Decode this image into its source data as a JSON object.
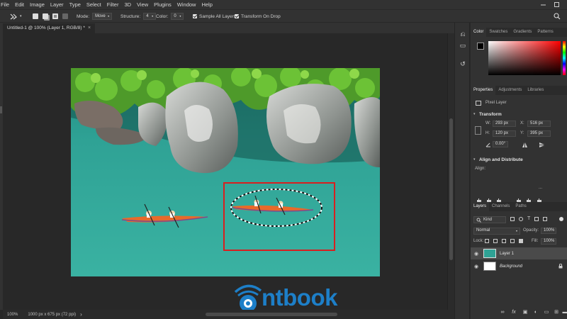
{
  "menubar": {
    "items": [
      "File",
      "Edit",
      "Image",
      "Layer",
      "Type",
      "Select",
      "Filter",
      "3D",
      "View",
      "Plugins",
      "Window",
      "Help"
    ]
  },
  "options": {
    "mode_label": "Mode:",
    "mode_value": "Move",
    "structure_label": "Structure:",
    "structure_value": "4",
    "color_label": "Color:",
    "color_value": "0",
    "sample_all_layers": "Sample All Layers",
    "transform_on_drop": "Transform On Drop"
  },
  "document": {
    "tab_title": "Untitled-1 @ 100% (Layer 1, RGB/8) *",
    "tab_close": "×"
  },
  "status": {
    "zoom": "100%",
    "doc_info": "1000 px x 675 px (72 ppi)",
    "arrow": "›"
  },
  "color_panel": {
    "tabs": [
      "Color",
      "Swatches",
      "Gradients",
      "Patterns"
    ],
    "foreground": "#000000",
    "background": "#ffffff",
    "hue_color": "#ff0000"
  },
  "properties_panel": {
    "tabs": [
      "Properties",
      "Adjustments",
      "Libraries"
    ],
    "layer_type": "Pixel Layer",
    "transform_title": "Transform",
    "w_label": "W:",
    "w_value": "293 px",
    "x_label": "X:",
    "x_value": "516 px",
    "h_label": "H:",
    "h_value": "120 px",
    "y_label": "Y:",
    "y_value": "395 px",
    "angle_value": "0.00°",
    "align_title": "Align and Distribute",
    "align_label": "Align:",
    "more": "..."
  },
  "layers_panel": {
    "tabs": [
      "Layers",
      "Channels",
      "Paths"
    ],
    "kind_value": "Kind",
    "blend_mode": "Normal",
    "opacity_label": "Opacity:",
    "opacity_value": "100%",
    "lock_label": "Lock:",
    "fill_label": "Fill:",
    "fill_value": "100%",
    "layers": [
      {
        "name": "Layer 1",
        "selected": true
      },
      {
        "name": "Background",
        "selected": false
      }
    ]
  },
  "watermark": {
    "text": "ntbook",
    "color": "#1d7fc8"
  },
  "colors": {
    "selection_box": "#d81f1f",
    "panel_bg": "#323232",
    "canvas_bg": "#282828"
  }
}
